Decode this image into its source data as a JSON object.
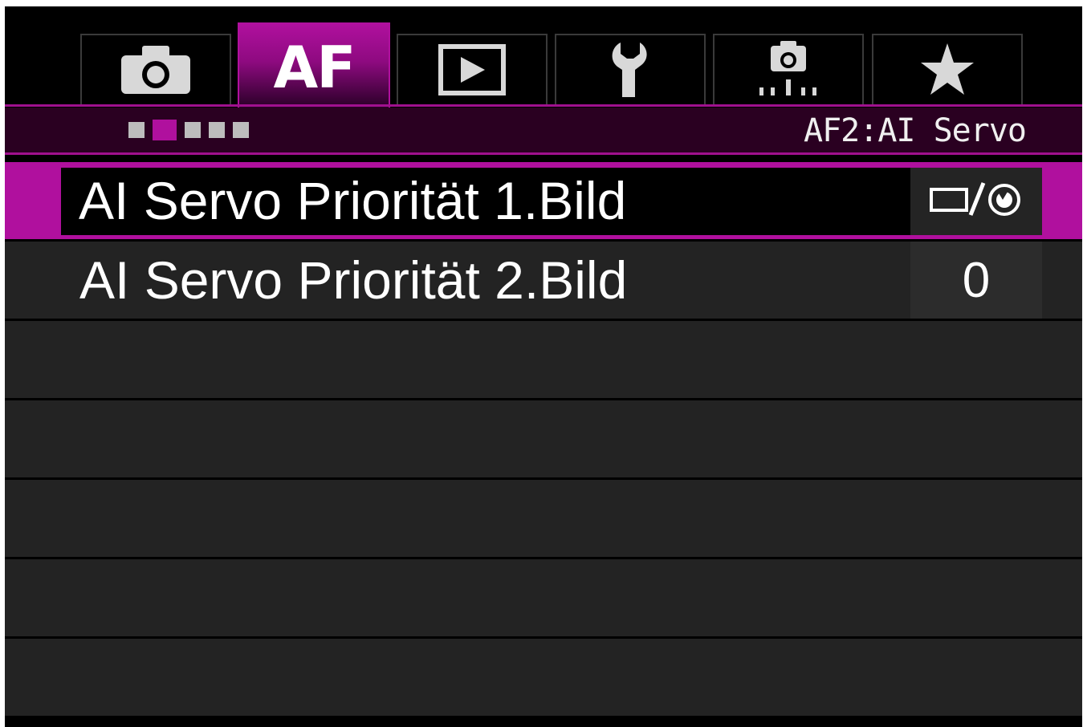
{
  "tabs": [
    {
      "icon": "camera-icon",
      "label": ""
    },
    {
      "icon": "af-text",
      "label": "AF"
    },
    {
      "icon": "playback-icon",
      "label": ""
    },
    {
      "icon": "wrench-icon",
      "label": ""
    },
    {
      "icon": "custom-functions-icon",
      "label": ""
    },
    {
      "icon": "star-icon",
      "label": ""
    }
  ],
  "active_tab": 1,
  "page_indicator": {
    "count": 5,
    "active": 1
  },
  "page_label": "AF2:AI Servo",
  "menu": {
    "items": [
      {
        "label": "AI Servo Priorität 1.Bild",
        "value_icon": "release-focus-icon",
        "selected": true
      },
      {
        "label": "AI Servo Priorität 2.Bild",
        "value": "0",
        "selected": false
      }
    ]
  },
  "colors": {
    "accent": "#b0109e",
    "row_bg": "#232323",
    "background": "#000000"
  }
}
